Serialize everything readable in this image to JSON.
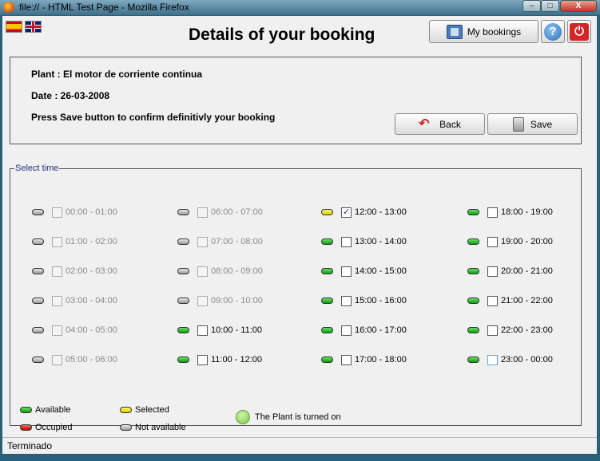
{
  "window": {
    "title": "file:// - HTML Test Page - Mozilla Firefox",
    "minimize": "–",
    "maximize": "□",
    "close": "X"
  },
  "header": {
    "title": "Details of your booking",
    "my_bookings_label": "My bookings",
    "help_glyph": "?",
    "power_glyph": "⏻",
    "languages": [
      {
        "code": "es",
        "icon": "spain-flag-icon"
      },
      {
        "code": "en",
        "icon": "uk-flag-icon"
      }
    ]
  },
  "booking": {
    "plant_line": "Plant : El motor de corriente continua",
    "date_line": "Date : 26-03-2008",
    "instruction": "Press Save button to confirm definitivly your booking",
    "back_label": "Back",
    "save_label": "Save"
  },
  "select_time": {
    "legend": "Select time",
    "columns": [
      [
        {
          "time": "00:00 - 01:00",
          "status": "not-available",
          "checked": false
        },
        {
          "time": "01:00 - 02:00",
          "status": "not-available",
          "checked": false
        },
        {
          "time": "02:00 - 03:00",
          "status": "not-available",
          "checked": false
        },
        {
          "time": "03:00 - 04:00",
          "status": "not-available",
          "checked": false
        },
        {
          "time": "04:00 - 05:00",
          "status": "not-available",
          "checked": false
        },
        {
          "time": "05:00 - 06:00",
          "status": "not-available",
          "checked": false
        }
      ],
      [
        {
          "time": "06:00 - 07:00",
          "status": "not-available",
          "checked": false
        },
        {
          "time": "07:00 - 08:00",
          "status": "not-available",
          "checked": false
        },
        {
          "time": "08:00 - 09:00",
          "status": "not-available",
          "checked": false
        },
        {
          "time": "09:00 - 10:00",
          "status": "not-available",
          "checked": false
        },
        {
          "time": "10:00 - 11:00",
          "status": "available",
          "checked": false
        },
        {
          "time": "11:00 - 12:00",
          "status": "available",
          "checked": false
        }
      ],
      [
        {
          "time": "12:00 - 13:00",
          "status": "selected",
          "checked": true
        },
        {
          "time": "13:00 - 14:00",
          "status": "available",
          "checked": false
        },
        {
          "time": "14:00 - 15:00",
          "status": "available",
          "checked": false
        },
        {
          "time": "15:00 - 16:00",
          "status": "available",
          "checked": false
        },
        {
          "time": "16:00 - 17:00",
          "status": "available",
          "checked": false
        },
        {
          "time": "17:00 - 18:00",
          "status": "available",
          "checked": false
        }
      ],
      [
        {
          "time": "18:00 - 19:00",
          "status": "available",
          "checked": false
        },
        {
          "time": "19:00 - 20:00",
          "status": "available",
          "checked": false
        },
        {
          "time": "20:00 - 21:00",
          "status": "available",
          "checked": false
        },
        {
          "time": "21:00 - 22:00",
          "status": "available",
          "checked": false
        },
        {
          "time": "22:00 - 23:00",
          "status": "available",
          "checked": false
        },
        {
          "time": "23:00 - 00:00",
          "status": "available",
          "checked": false
        }
      ]
    ],
    "key": {
      "available": "Available",
      "occupied": "Occupied",
      "selected": "Selected",
      "not_available": "Not available",
      "plant_status": "The Plant is turned on"
    }
  },
  "status_bar": {
    "text": "Terminado"
  },
  "colors": {
    "available": "#0aa00a",
    "selected": "#d9cc00",
    "occupied": "#cc0000",
    "not_available": "#9a9a9a",
    "legend_text": "#1c2f82"
  }
}
